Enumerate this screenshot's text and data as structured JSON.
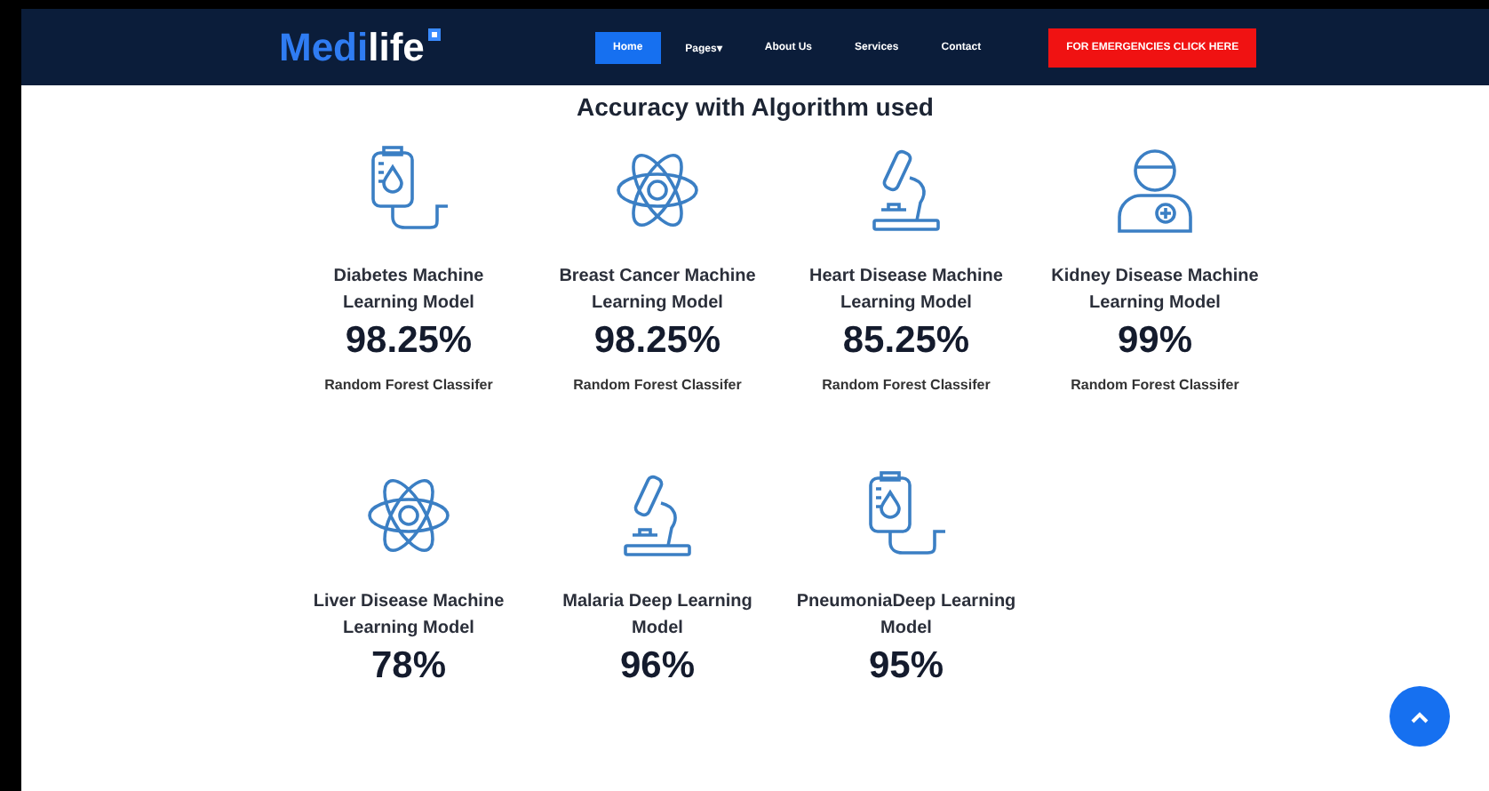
{
  "navbar": {
    "logo": {
      "part_1": "Medi",
      "part_2": "life"
    },
    "items": [
      {
        "label": "Home",
        "selected": true
      },
      {
        "label": "Pages▾",
        "selected": false
      },
      {
        "label": "About Us",
        "selected": false
      },
      {
        "label": "Services",
        "selected": false
      },
      {
        "label": "Contact",
        "selected": false
      }
    ],
    "emergency_button": "FOR EMERGENCIES CLICK HERE"
  },
  "heading": "Accuracy with Algorithm used",
  "models": [
    {
      "kind": "iv-bag",
      "title": "Diabetes Machine Learning Model",
      "accuracy": "98.25%",
      "algorithm": "Random Forest Classifer"
    },
    {
      "kind": "atom",
      "title": "Breast Cancer Machine Learning Model",
      "accuracy": "98.25%",
      "algorithm": "Random Forest Classifer"
    },
    {
      "kind": "microscope",
      "title": "Heart Disease Machine Learning Model",
      "accuracy": "85.25%",
      "algorithm": "Random Forest Classifer"
    },
    {
      "kind": "doctor",
      "title": "Kidney Disease Machine Learning Model",
      "accuracy": "99%",
      "algorithm": "Random Forest Classifer"
    },
    {
      "kind": "atom",
      "title": "Liver Disease Machine Learning Model",
      "accuracy": "78%"
    },
    {
      "kind": "microscope",
      "title": "Malaria Deep Learning Model",
      "accuracy": "96%"
    },
    {
      "kind": "iv-bag",
      "title": "PneumoniaDeep Learning Model",
      "accuracy": "95%"
    }
  ]
}
